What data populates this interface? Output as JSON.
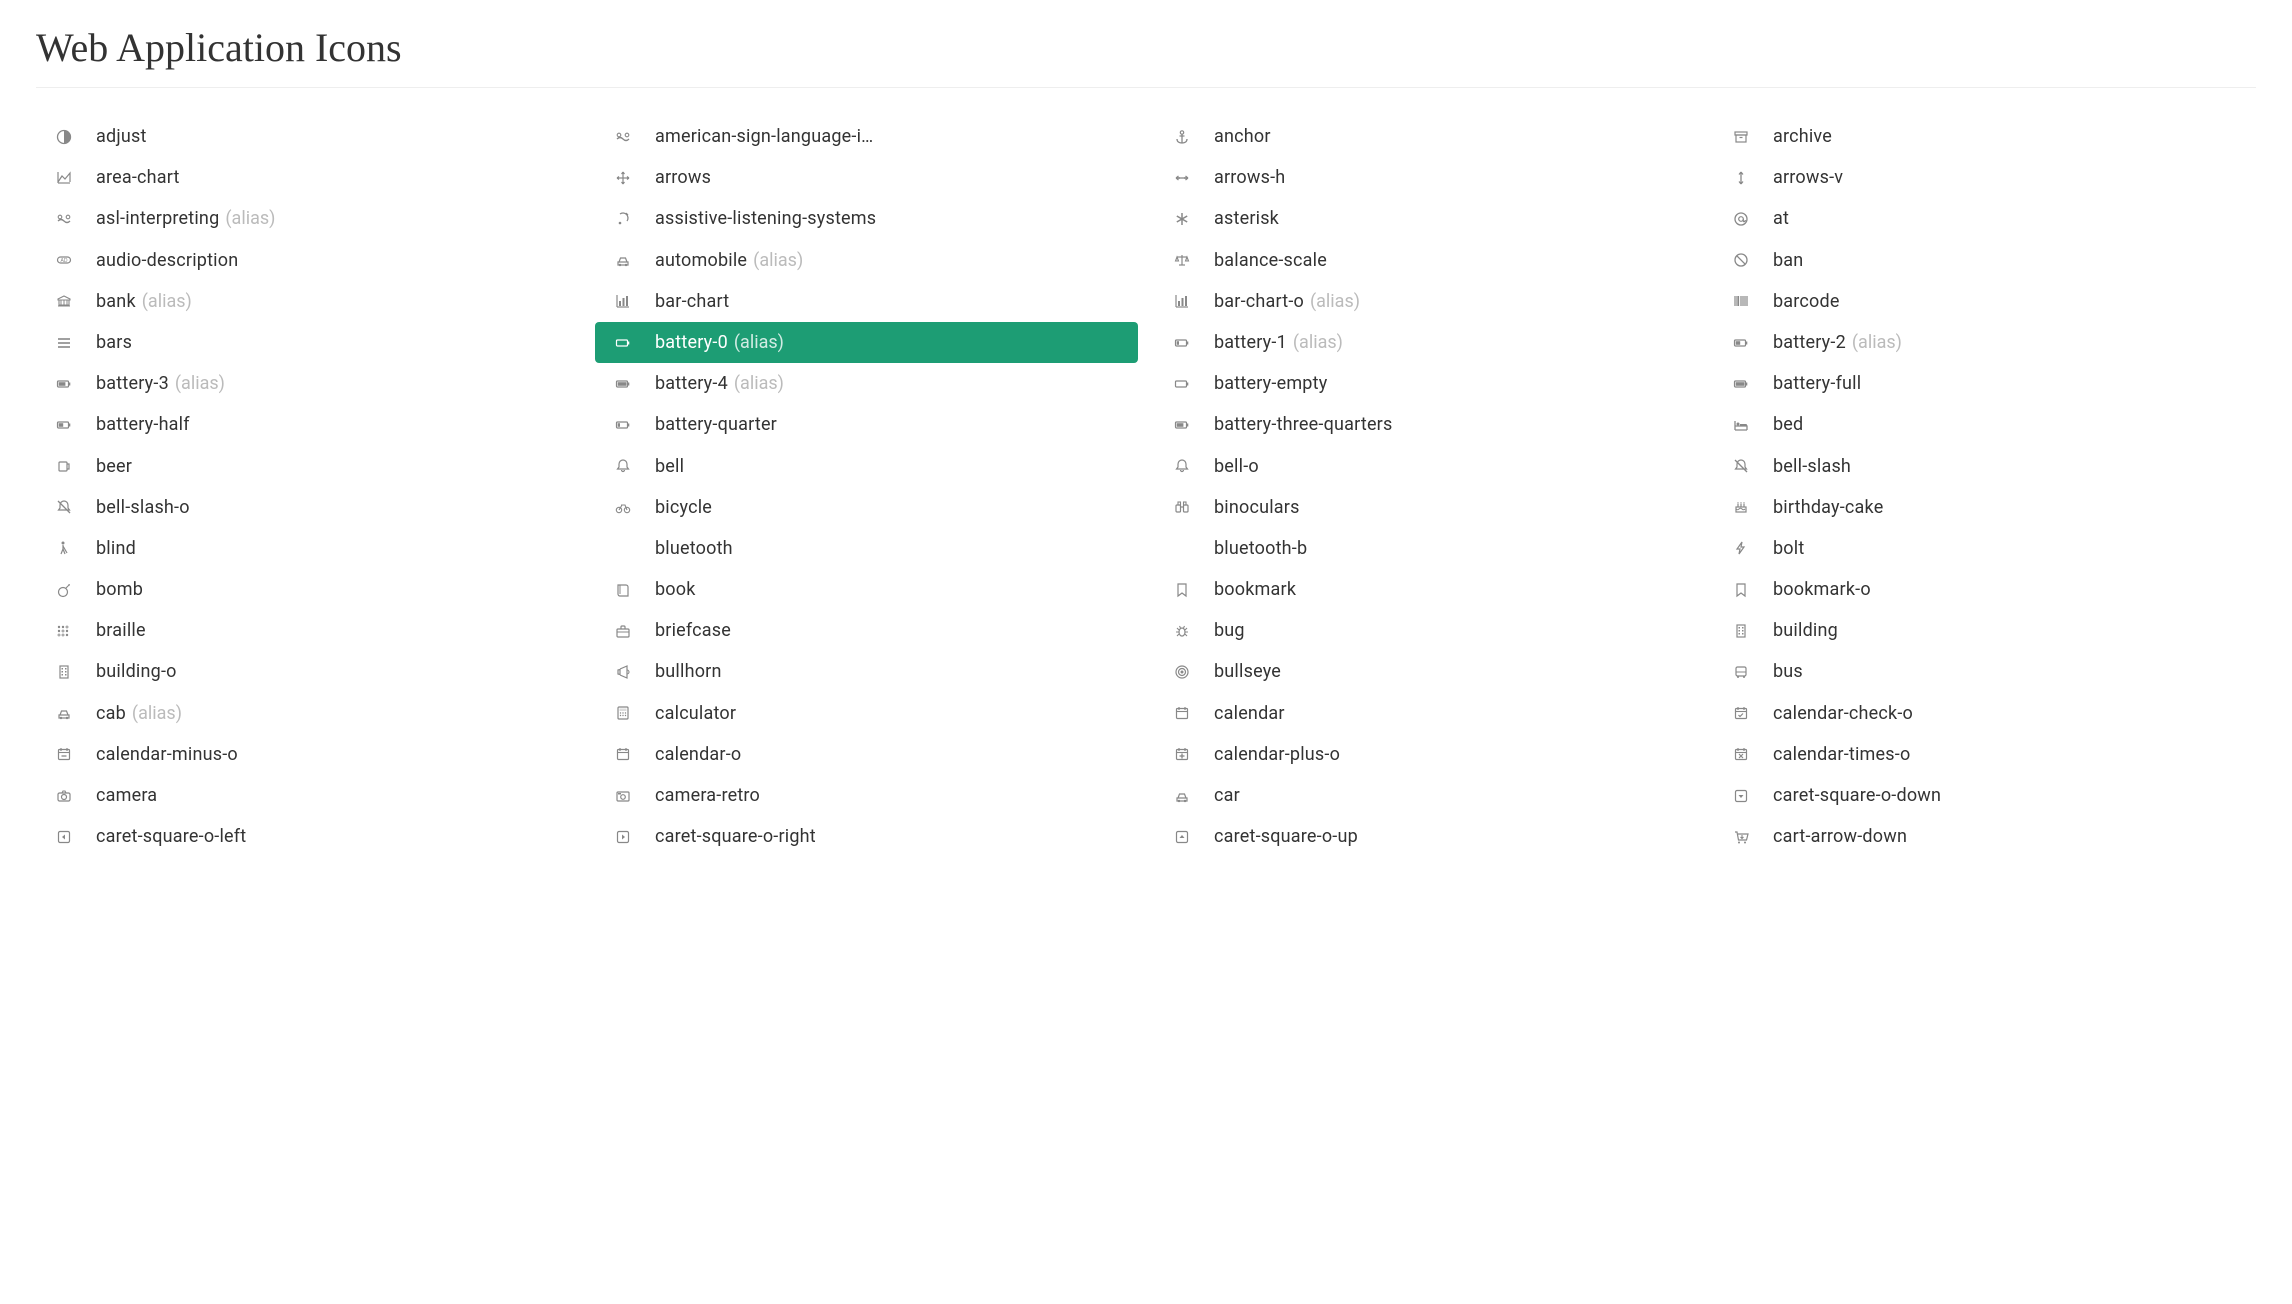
{
  "section_title": "Web Application Icons",
  "alias_text": "(alias)",
  "icons": [
    {
      "name": "adjust",
      "glyph": "adjust"
    },
    {
      "name": "american-sign-language-interpreting",
      "glyph": "asl",
      "truncate": true
    },
    {
      "name": "anchor",
      "glyph": "anchor"
    },
    {
      "name": "archive",
      "glyph": "archive"
    },
    {
      "name": "area-chart",
      "glyph": "area-chart"
    },
    {
      "name": "arrows",
      "glyph": "arrows"
    },
    {
      "name": "arrows-h",
      "glyph": "arrows-h"
    },
    {
      "name": "arrows-v",
      "glyph": "arrows-v"
    },
    {
      "name": "asl-interpreting",
      "glyph": "asl",
      "alias": true
    },
    {
      "name": "assistive-listening-systems",
      "glyph": "assist-listen"
    },
    {
      "name": "asterisk",
      "glyph": "asterisk"
    },
    {
      "name": "at",
      "glyph": "at"
    },
    {
      "name": "audio-description",
      "glyph": "audio-desc"
    },
    {
      "name": "automobile",
      "glyph": "car",
      "alias": true
    },
    {
      "name": "balance-scale",
      "glyph": "balance"
    },
    {
      "name": "ban",
      "glyph": "ban"
    },
    {
      "name": "bank",
      "glyph": "bank",
      "alias": true
    },
    {
      "name": "bar-chart",
      "glyph": "bar-chart"
    },
    {
      "name": "bar-chart-o",
      "glyph": "bar-chart",
      "alias": true
    },
    {
      "name": "barcode",
      "glyph": "barcode"
    },
    {
      "name": "bars",
      "glyph": "bars"
    },
    {
      "name": "battery-0",
      "glyph": "battery-0",
      "alias": true,
      "selected": true
    },
    {
      "name": "battery-1",
      "glyph": "battery-1",
      "alias": true
    },
    {
      "name": "battery-2",
      "glyph": "battery-2",
      "alias": true
    },
    {
      "name": "battery-3",
      "glyph": "battery-3",
      "alias": true
    },
    {
      "name": "battery-4",
      "glyph": "battery-4",
      "alias": true
    },
    {
      "name": "battery-empty",
      "glyph": "battery-0"
    },
    {
      "name": "battery-full",
      "glyph": "battery-4"
    },
    {
      "name": "battery-half",
      "glyph": "battery-2"
    },
    {
      "name": "battery-quarter",
      "glyph": "battery-1"
    },
    {
      "name": "battery-three-quarters",
      "glyph": "battery-3"
    },
    {
      "name": "bed",
      "glyph": "bed"
    },
    {
      "name": "beer",
      "glyph": "beer"
    },
    {
      "name": "bell",
      "glyph": "bell"
    },
    {
      "name": "bell-o",
      "glyph": "bell"
    },
    {
      "name": "bell-slash",
      "glyph": "bell-slash"
    },
    {
      "name": "bell-slash-o",
      "glyph": "bell-slash"
    },
    {
      "name": "bicycle",
      "glyph": "bicycle"
    },
    {
      "name": "binoculars",
      "glyph": "binoculars"
    },
    {
      "name": "birthday-cake",
      "glyph": "cake"
    },
    {
      "name": "blind",
      "glyph": "blind"
    },
    {
      "name": "bluetooth",
      "glyph": ""
    },
    {
      "name": "bluetooth-b",
      "glyph": ""
    },
    {
      "name": "bolt",
      "glyph": "bolt"
    },
    {
      "name": "bomb",
      "glyph": "bomb"
    },
    {
      "name": "book",
      "glyph": "book"
    },
    {
      "name": "bookmark",
      "glyph": "bookmark"
    },
    {
      "name": "bookmark-o",
      "glyph": "bookmark"
    },
    {
      "name": "braille",
      "glyph": "braille"
    },
    {
      "name": "briefcase",
      "glyph": "briefcase"
    },
    {
      "name": "bug",
      "glyph": "bug"
    },
    {
      "name": "building",
      "glyph": "building"
    },
    {
      "name": "building-o",
      "glyph": "building"
    },
    {
      "name": "bullhorn",
      "glyph": "bullhorn"
    },
    {
      "name": "bullseye",
      "glyph": "bullseye"
    },
    {
      "name": "bus",
      "glyph": "bus"
    },
    {
      "name": "cab",
      "glyph": "car",
      "alias": true
    },
    {
      "name": "calculator",
      "glyph": "calculator"
    },
    {
      "name": "calendar",
      "glyph": "calendar"
    },
    {
      "name": "calendar-check-o",
      "glyph": "calendar-check"
    },
    {
      "name": "calendar-minus-o",
      "glyph": "calendar-minus"
    },
    {
      "name": "calendar-o",
      "glyph": "calendar-o"
    },
    {
      "name": "calendar-plus-o",
      "glyph": "calendar-plus"
    },
    {
      "name": "calendar-times-o",
      "glyph": "calendar-times"
    },
    {
      "name": "camera",
      "glyph": "camera"
    },
    {
      "name": "camera-retro",
      "glyph": "camera-retro"
    },
    {
      "name": "car",
      "glyph": "car"
    },
    {
      "name": "caret-square-o-down",
      "glyph": "caret-sq-down"
    },
    {
      "name": "caret-square-o-left",
      "glyph": "caret-sq-left"
    },
    {
      "name": "caret-square-o-right",
      "glyph": "caret-sq-right"
    },
    {
      "name": "caret-square-o-up",
      "glyph": "caret-sq-up"
    },
    {
      "name": "cart-arrow-down",
      "glyph": "cart"
    }
  ]
}
